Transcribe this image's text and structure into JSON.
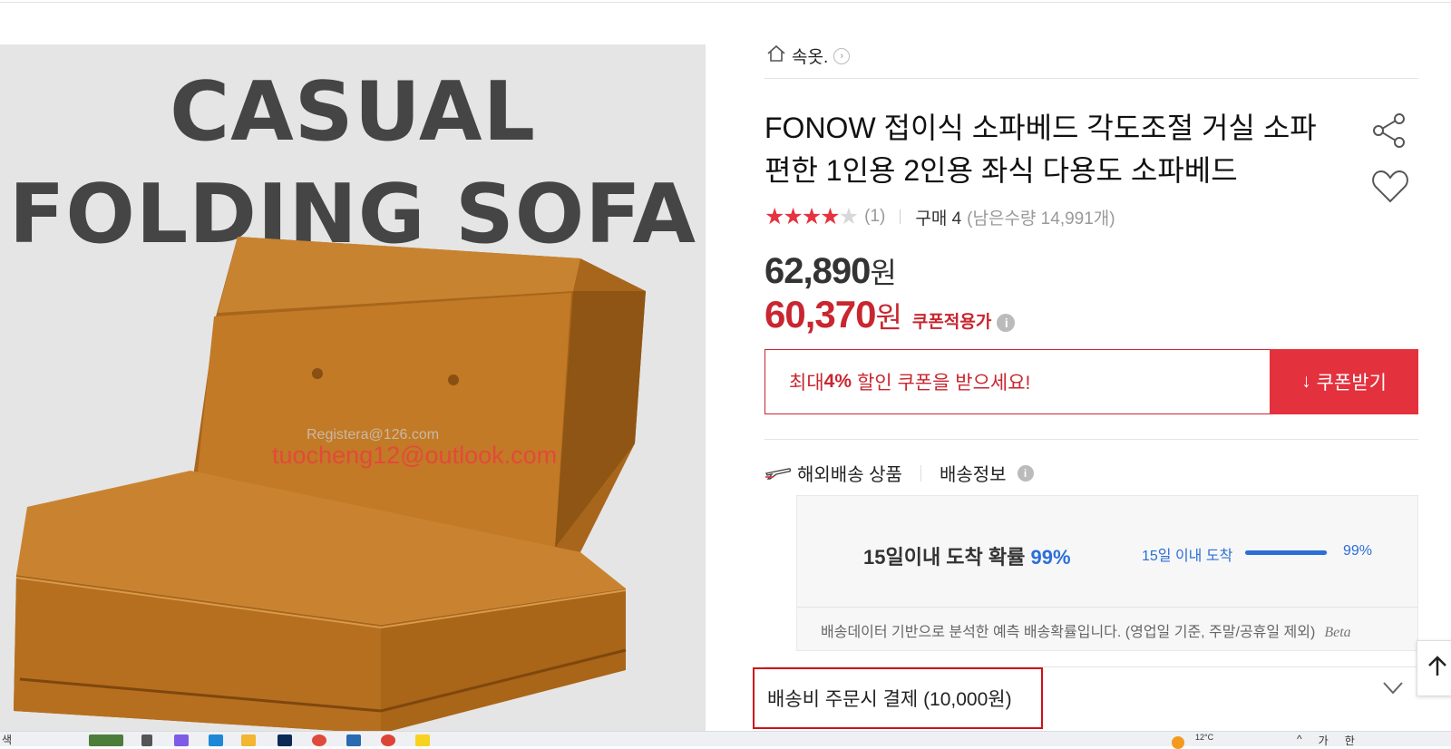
{
  "product_image": {
    "banner_line1": "CASUAL",
    "banner_line2": "FOLDING SOFA",
    "watermark_small": "Registera@126.com",
    "watermark_large": "tuocheng12@outlook.com"
  },
  "breadcrumb": {
    "category": "속옷."
  },
  "product": {
    "title": "FONOW 접이식 소파베드 각도조절 거실 소파 편한 1인용 2인용 좌식 다용도 소파베드",
    "rating": 4,
    "rating_max": 5,
    "review_count": "(1)",
    "purchase_text": "구매 4",
    "remaining_text": "(남은수량 14,991개)"
  },
  "price": {
    "original_amount": "62,890",
    "original_unit": "원",
    "coupon_amount": "60,370",
    "coupon_unit": "원",
    "coupon_label": "쿠폰적용가",
    "info_glyph": "i"
  },
  "coupon": {
    "text_prefix": "최대 ",
    "text_percent": "4%",
    "text_suffix": " 할인 쿠폰을 받으세요!",
    "button_label": "쿠폰받기",
    "button_glyph": "↓"
  },
  "shipping": {
    "overseas_label": "해외배송 상품",
    "info_label": "배송정보",
    "probability_title": "15일이내 도착 확률",
    "probability_value": "99%",
    "bar_label": "15일 이내 도착",
    "bar_value_text": "99%",
    "bar_fraction": 0.99,
    "note": "배송데이터 기반으로 분석한 예측 배송확률입니다. (영업일 기준, 주말/공휴일 제외)",
    "beta_label": "Beta"
  },
  "fee": {
    "text": "배송비 주문시 결제 (10,000원)"
  },
  "taskbar": {
    "search_text": "색",
    "weather_temp": "12°C",
    "ime_1": "가",
    "ime_2": "한"
  },
  "colors": {
    "accent_red": "#e3313d",
    "price_red": "#c9262f",
    "star_red": "#e53340",
    "probability_blue": "#2b6fd6"
  }
}
